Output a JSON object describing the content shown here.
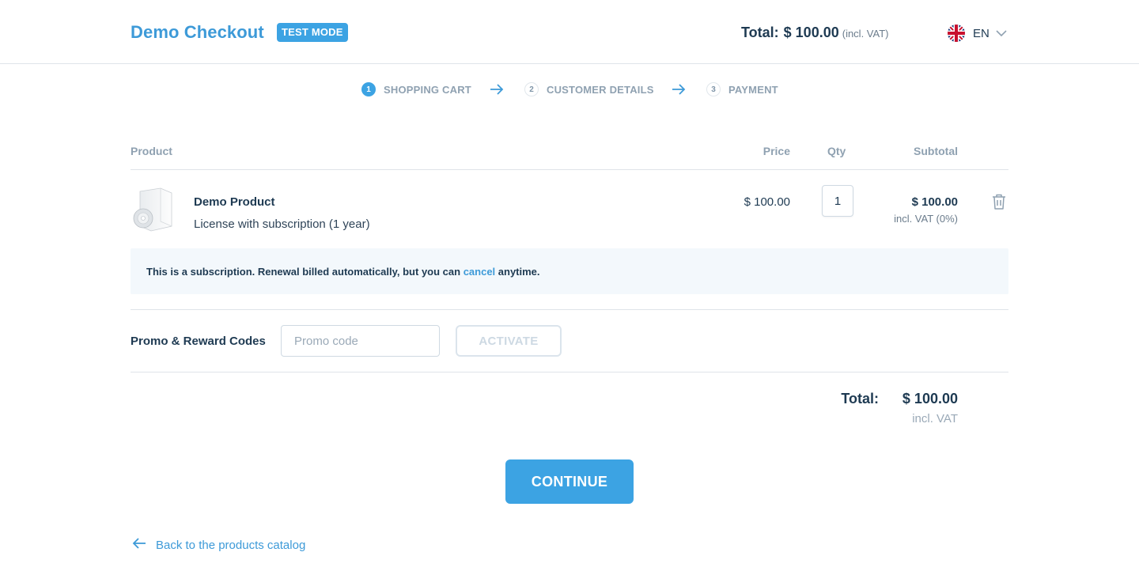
{
  "header": {
    "brand": "Demo Checkout",
    "badge": "TEST MODE",
    "total_label": "Total:",
    "total_amount": "$ 100.00",
    "total_vat": "(incl. VAT)",
    "language": "EN",
    "flag_icon": "uk-flag-icon"
  },
  "steps": [
    {
      "number": "1",
      "label": "SHOPPING CART",
      "active": true
    },
    {
      "number": "2",
      "label": "CUSTOMER DETAILS",
      "active": false
    },
    {
      "number": "3",
      "label": "PAYMENT",
      "active": false
    }
  ],
  "table": {
    "headers": {
      "product": "Product",
      "price": "Price",
      "qty": "Qty",
      "subtotal": "Subtotal"
    }
  },
  "product": {
    "name": "Demo Product",
    "description": "License with subscription (1 year)",
    "price": "$ 100.00",
    "qty": "1",
    "subtotal": "$ 100.00",
    "subtotal_vat": "incl. VAT (0%)"
  },
  "notice": {
    "before": "This is a subscription. Renewal billed automatically, but you can ",
    "link": "cancel",
    "after": " anytime."
  },
  "promo": {
    "label": "Promo & Reward Codes",
    "placeholder": "Promo code",
    "button": "ACTIVATE"
  },
  "summary": {
    "label": "Total:",
    "amount": "$ 100.00",
    "vat": "incl. VAT"
  },
  "continue_button": "CONTINUE",
  "back_link": "Back to the products catalog",
  "colors": {
    "accent": "#3ca3e3",
    "brand": "#3d9ad8",
    "text": "#1e3a52",
    "muted": "#8fa1b1",
    "notice_bg": "#f3f8fc"
  }
}
